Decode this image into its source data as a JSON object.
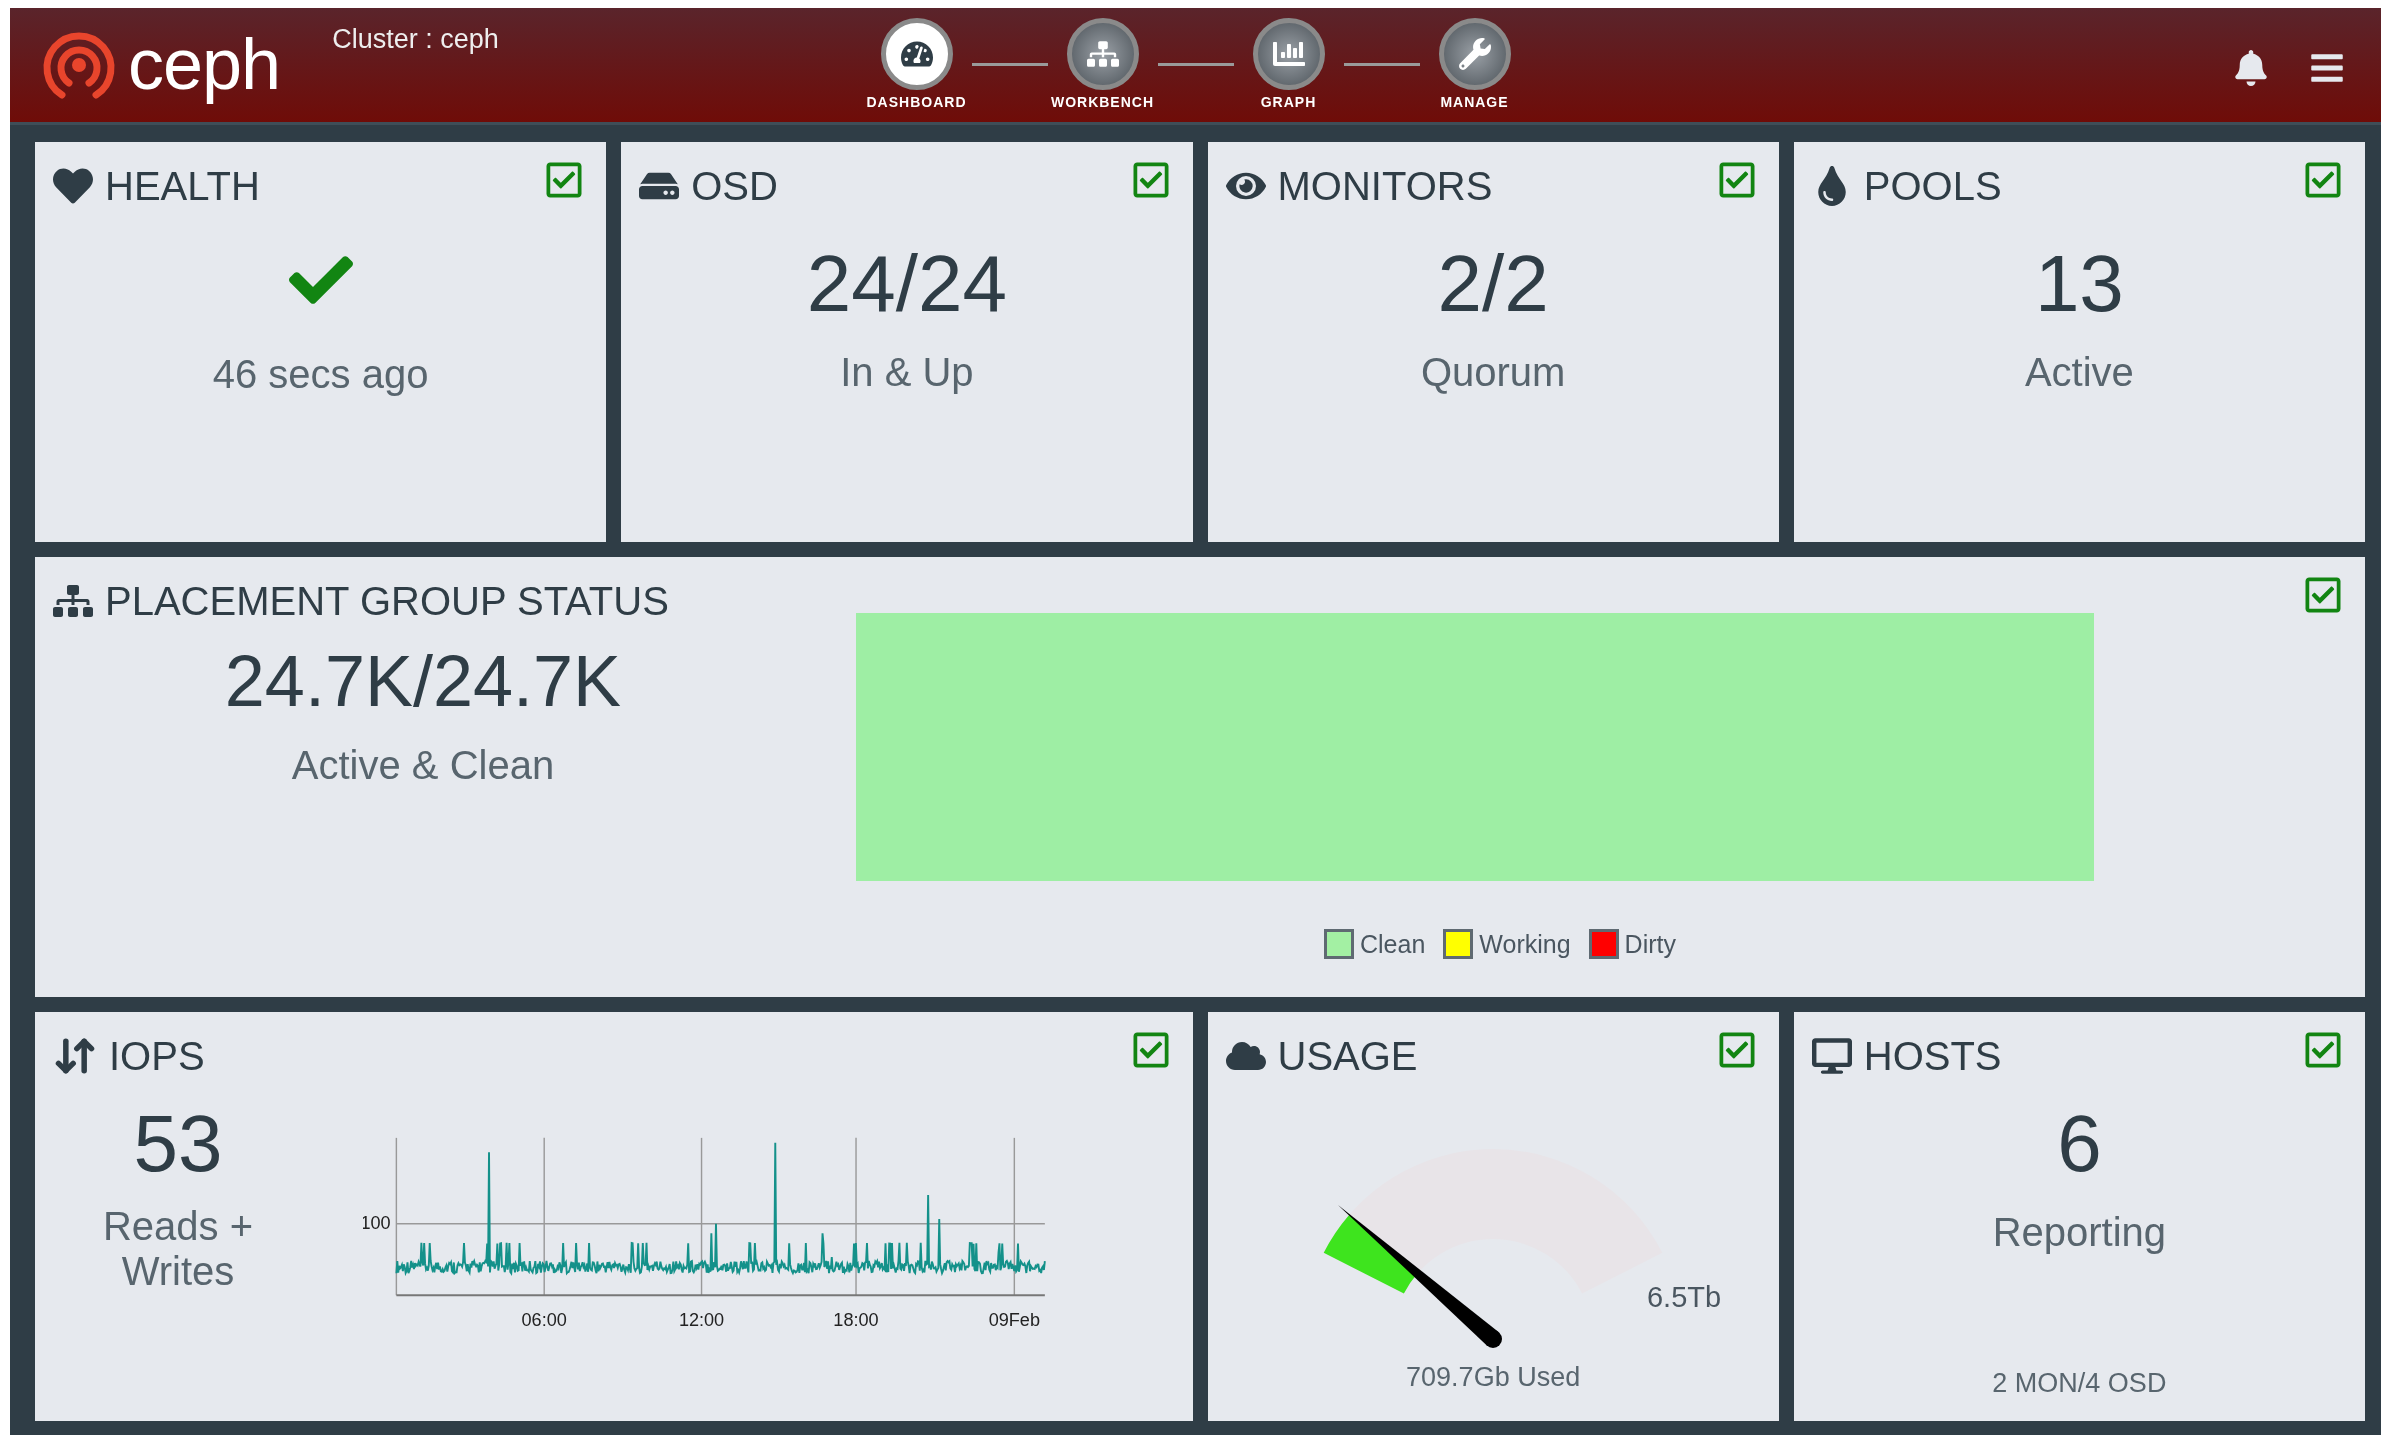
{
  "header": {
    "logo": "ceph",
    "cluster": "Cluster : ceph",
    "nav": [
      {
        "label": "DASHBOARD",
        "kind": "dashboard",
        "selected": true
      },
      {
        "label": "WORKBENCH",
        "kind": "workbench",
        "selected": false
      },
      {
        "label": "GRAPH",
        "kind": "graph",
        "selected": false
      },
      {
        "label": "MANAGE",
        "kind": "manage",
        "selected": false
      }
    ]
  },
  "top_cards": [
    {
      "kind": "health",
      "title": "HEALTH",
      "checked": true,
      "caption": "46 secs ago"
    },
    {
      "kind": "osd",
      "title": "OSD",
      "checked": true,
      "value": "24/24",
      "caption": "In & Up"
    },
    {
      "kind": "monitors",
      "title": "MONITORS",
      "checked": true,
      "value": "2/2",
      "caption": "Quorum"
    },
    {
      "kind": "pools",
      "title": "POOLS",
      "checked": true,
      "value": "13",
      "caption": "Active"
    }
  ],
  "pg": {
    "title": "PLACEMENT GROUP STATUS",
    "checked": true,
    "value": "24.7K/24.7K",
    "caption": "Active & Clean",
    "legend": [
      {
        "label": "Clean",
        "color": "#a3f0a3"
      },
      {
        "label": "Working",
        "color": "#ffff00"
      },
      {
        "label": "Dirty",
        "color": "#ff0000"
      }
    ]
  },
  "iops": {
    "title": "IOPS",
    "checked": true,
    "value": "53",
    "caption": "Reads + Writes",
    "chart": {
      "y_tick": "100",
      "x_ticks": [
        "06:00",
        "12:00",
        "18:00",
        "09Feb"
      ]
    }
  },
  "usage": {
    "title": "USAGE",
    "checked": true,
    "capacity": "6.5Tb",
    "caption": "709.7Gb Used"
  },
  "hosts": {
    "title": "HOSTS",
    "checked": true,
    "value": "6",
    "caption": "Reporting",
    "footer": "2 MON/4 OSD"
  }
}
